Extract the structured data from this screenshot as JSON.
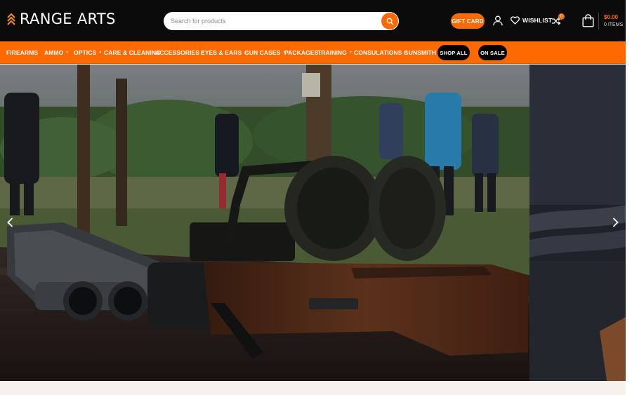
{
  "brand": {
    "name": "RANGE ARTS"
  },
  "search": {
    "placeholder": "Search for products"
  },
  "header": {
    "gift_card_label": "GIFT CARD",
    "wishlist_label": "WISHLIST",
    "compare_count": "0",
    "cart_total": "$0.00",
    "cart_items": "0 ITEMS"
  },
  "nav": {
    "items": [
      {
        "label": "FIREARMS",
        "has_dropdown": false
      },
      {
        "label": "AMMO",
        "has_dropdown": true
      },
      {
        "label": "OPTICS",
        "has_dropdown": true
      },
      {
        "label": "CARE & CLEANING",
        "has_dropdown": false
      },
      {
        "label": "ACCESSORIES",
        "has_dropdown": true
      },
      {
        "label": "EYES & EARS",
        "has_dropdown": true
      },
      {
        "label": "GUN CASES",
        "has_dropdown": true
      },
      {
        "label": "PACKAGES",
        "has_dropdown": false
      },
      {
        "label": "TRAINING",
        "has_dropdown": true
      },
      {
        "label": "CONSULATIONS",
        "has_dropdown": true
      },
      {
        "label": "GUNSMITH",
        "has_dropdown": false
      }
    ],
    "shop_all_label": "SHOP ALL",
    "on_sale_label": "ON SALE"
  },
  "colors": {
    "accent": "#ff6a00",
    "header_bg": "#0b0b0b",
    "pill_bg": "#000000"
  },
  "icons": {
    "search": "search-icon",
    "account": "user-icon",
    "wishlist": "heart-icon",
    "compare": "shuffle-icon",
    "cart": "shopping-bag-icon",
    "slider_prev": "chevron-left-icon",
    "slider_next": "chevron-right-icon"
  }
}
